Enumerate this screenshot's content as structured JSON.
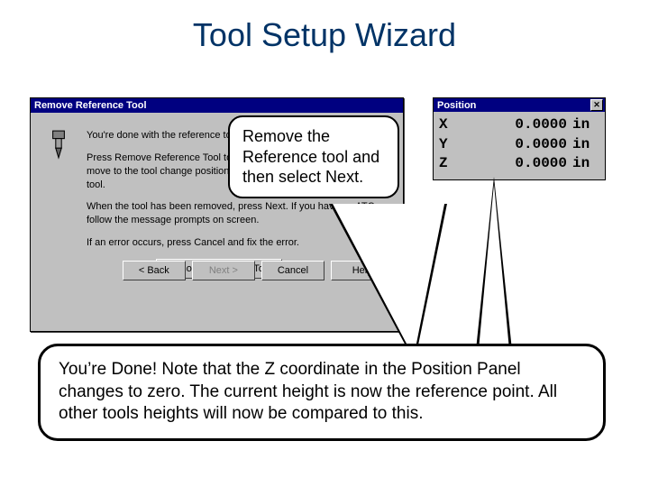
{
  "slide_title": "Tool Setup Wizard",
  "wizard": {
    "title": "Remove Reference Tool",
    "p1": "You're done with the reference tool.",
    "p2": "Press Remove Reference Tool to remove the tool; the machine will move to the tool change position so you can remove the reference tool.",
    "p3": "When the tool has been removed, press Next. If you have an ATC, follow the message prompts on screen.",
    "p4": "If an error occurs, press Cancel and fix the error.",
    "remove_btn_pre": "R",
    "remove_btn_rest": "emove Reference Tool",
    "back": "< Back",
    "next": "Next >",
    "cancel": "Cancel",
    "help": "Help"
  },
  "position": {
    "title": "Position",
    "rows": [
      {
        "axis": "X",
        "val": "0.0000",
        "unit": "in"
      },
      {
        "axis": "Y",
        "val": "0.0000",
        "unit": "in"
      },
      {
        "axis": "Z",
        "val": "0.0000",
        "unit": "in"
      }
    ]
  },
  "callout1": "Remove the Reference tool and then select Next.",
  "callout2": "You’re Done! Note that the Z coordinate in the Position Panel changes to zero. The current height is now the reference point. All other tools heights will now be compared to this."
}
